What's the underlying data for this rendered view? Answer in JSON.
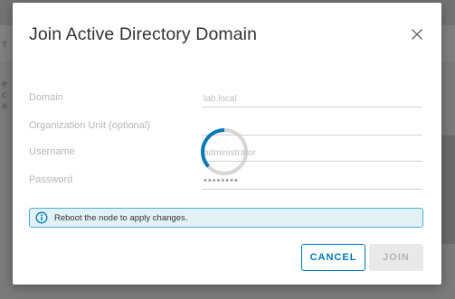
{
  "background": {
    "fragments": [
      "T",
      "e",
      "c",
      "a"
    ]
  },
  "dialog": {
    "title": "Join Active Directory Domain",
    "close_icon": "close-icon",
    "fields": {
      "domain": {
        "label": "Domain",
        "value": "lab.local"
      },
      "organization_unit": {
        "label": "Organization Unit (optional)",
        "value": ""
      },
      "username": {
        "label": "Username",
        "value": "administrator"
      },
      "password": {
        "label": "Password",
        "value": "••••••••"
      }
    },
    "loading_icon": "spinner-icon",
    "alert": {
      "icon": "info-icon",
      "message": "Reboot the node to apply changes."
    },
    "buttons": {
      "cancel": "CANCEL",
      "join": "JOIN"
    }
  },
  "colors": {
    "accent": "#0079b8",
    "alert_bg": "#e1f1f6",
    "alert_border": "#49afd9",
    "disabled_bg": "#e9e9e9"
  }
}
